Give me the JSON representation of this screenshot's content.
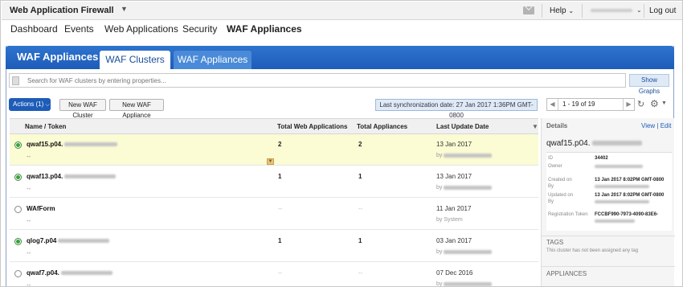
{
  "topbar": {
    "app_title": "Web Application Firewall",
    "help": "Help",
    "logout": "Log out"
  },
  "nav": [
    "Dashboard",
    "Events",
    "Web Applications",
    "Security",
    "WAF Appliances"
  ],
  "panel": {
    "title": "WAF Appliances",
    "tabs": [
      "WAF Clusters",
      "WAF Appliances"
    ]
  },
  "search": {
    "placeholder": "Search for WAF clusters by entering properties...",
    "show_graphs": "Show Graphs"
  },
  "toolbar": {
    "actions": "Actions (1)",
    "new_cluster": "New WAF Cluster",
    "new_appliance": "New WAF Appliance",
    "sync": "Last synchronization date: 27 Jan 2017 1:36PM GMT-0800",
    "pager": "1 - 19 of 19"
  },
  "table": {
    "headers": [
      "Name / Token",
      "Total Web Applications",
      "Total Appliances",
      "Last Update Date"
    ],
    "rows": [
      {
        "name": "qwaf15.p04.",
        "sub": "--",
        "web_apps": "2",
        "appliances": "2",
        "date": "13 Jan 2017",
        "by": "by",
        "selected": true
      },
      {
        "name": "qwaf13.p04.",
        "sub": "--",
        "web_apps": "1",
        "appliances": "1",
        "date": "13 Jan 2017",
        "by": "by",
        "selected": true
      },
      {
        "name": "WAfForm",
        "sub": "--",
        "web_apps": "--",
        "appliances": "--",
        "date": "11 Jan 2017",
        "by": "by System",
        "selected": false
      },
      {
        "name": "qlog7.p04",
        "sub": "--",
        "web_apps": "1",
        "appliances": "1",
        "date": "03 Jan 2017",
        "by": "by",
        "selected": true
      },
      {
        "name": "qwaf7.p04.",
        "sub": "--",
        "web_apps": "--",
        "appliances": "--",
        "date": "07 Dec 2016",
        "by": "by",
        "selected": false
      }
    ]
  },
  "details": {
    "header": "Details",
    "actions": "View | Edit",
    "title": "qwaf15.p04.",
    "fields": {
      "id_label": "ID",
      "id_value": "34402",
      "owner_label": "Owner",
      "created_label": "Created on",
      "created_by_label": "By",
      "created_value": "13 Jan 2017 8:02PM GMT-0800",
      "updated_label": "Updated on",
      "updated_by_label": "By",
      "updated_value": "13 Jan 2017 8:02PM GMT-0800",
      "token_label": "Registration Token",
      "token_value": "FCCBF990-7973-4090-83E6-"
    },
    "tags_title": "TAGS",
    "tags_note": "This cluster has not been assigned any tag",
    "appliances_title": "APPLIANCES"
  }
}
